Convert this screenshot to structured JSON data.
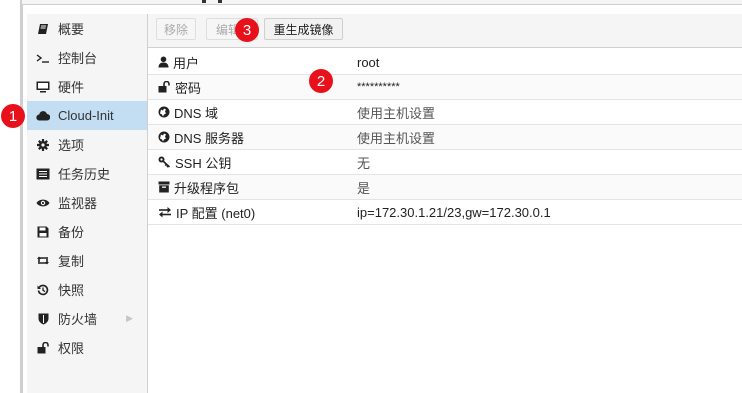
{
  "sidebar": {
    "items": [
      {
        "label": "概要",
        "icon": "book-icon"
      },
      {
        "label": "控制台",
        "icon": "terminal-icon"
      },
      {
        "label": "硬件",
        "icon": "monitor-icon"
      },
      {
        "label": "Cloud-Init",
        "icon": "cloud-icon"
      },
      {
        "label": "选项",
        "icon": "gear-icon"
      },
      {
        "label": "任务历史",
        "icon": "list-icon"
      },
      {
        "label": "监视器",
        "icon": "eye-icon"
      },
      {
        "label": "备份",
        "icon": "floppy-disk-icon"
      },
      {
        "label": "复制",
        "icon": "retweet-icon"
      },
      {
        "label": "快照",
        "icon": "history-icon"
      },
      {
        "label": "防火墙",
        "icon": "shield-icon"
      },
      {
        "label": "权限",
        "icon": "unlock-icon"
      }
    ],
    "selected": "Cloud-Init"
  },
  "toolbar": {
    "remove_label": "移除",
    "edit_label": "编辑",
    "regenerate_label": "重生成镜像"
  },
  "rows": [
    {
      "key": "用户",
      "value": "root",
      "icon": "user-icon"
    },
    {
      "key": "密码",
      "value": "**********",
      "icon": "unlock-icon"
    },
    {
      "key": "DNS 域",
      "value": "使用主机设置",
      "icon": "globe-icon"
    },
    {
      "key": "DNS 服务器",
      "value": "使用主机设置",
      "icon": "globe-icon"
    },
    {
      "key": "SSH 公钥",
      "value": "无",
      "icon": "key-icon"
    },
    {
      "key": "升级程序包",
      "value": "是",
      "icon": "archive-icon"
    },
    {
      "key": "IP 配置 (net0)",
      "value": "ip=172.30.1.21/23,gw=172.30.0.1",
      "icon": "exchange-icon"
    }
  ],
  "annotations": [
    "1",
    "2",
    "3"
  ],
  "colors": {
    "selected_bg": "#c3ddf3",
    "badge": "#e8111b"
  }
}
